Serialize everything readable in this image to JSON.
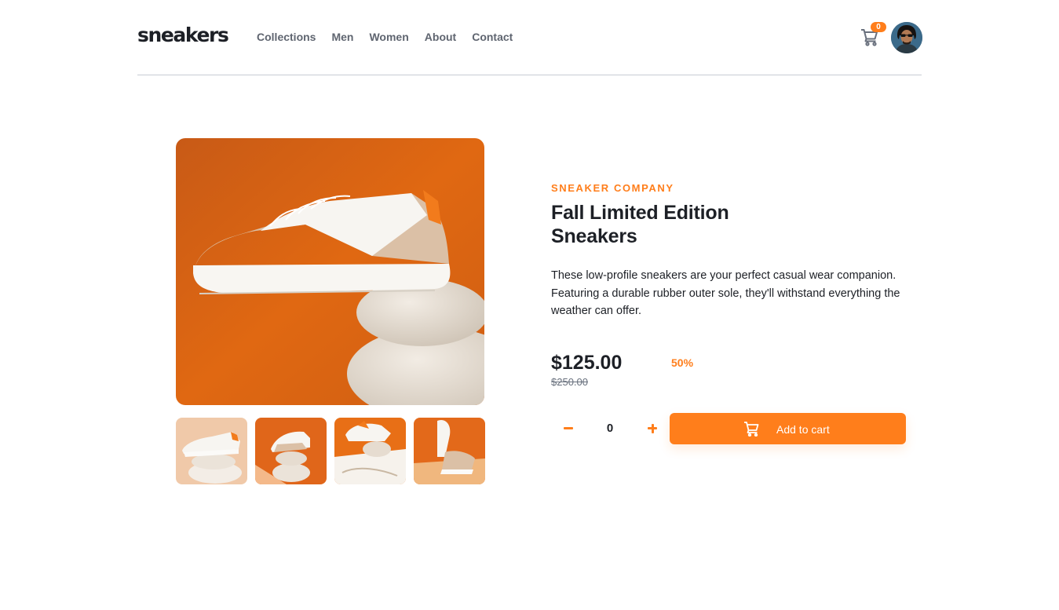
{
  "header": {
    "logo": "sneakers",
    "nav": [
      {
        "label": "Collections"
      },
      {
        "label": "Men"
      },
      {
        "label": "Women"
      },
      {
        "label": "About"
      },
      {
        "label": "Contact"
      }
    ],
    "cart_count": "0",
    "cart_icon": "cart-icon",
    "avatar": "user-avatar"
  },
  "product": {
    "company": "SNEAKER COMPANY",
    "title": "Fall Limited Edition Sneakers",
    "description": "These low-profile sneakers are your perfect casual wear companion. Featuring a durable rubber outer sole, they'll withstand everything the weather can offer.",
    "price": "$125.00",
    "discount": "50%",
    "old_price": "$250.00",
    "quantity": "0",
    "add_to_cart": "Add to cart"
  },
  "gallery": {
    "thumbnails": [
      "product-1",
      "product-2",
      "product-3",
      "product-4"
    ]
  },
  "colors": {
    "accent": "#ff7e1b",
    "text": "#1d2026",
    "muted": "#68707d"
  }
}
